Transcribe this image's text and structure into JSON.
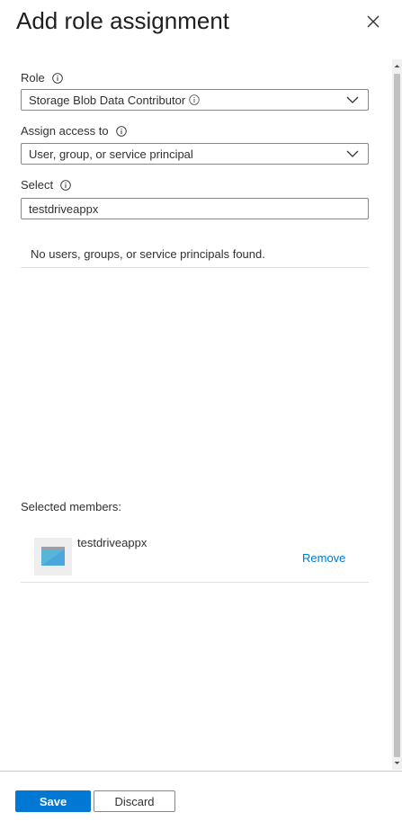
{
  "panel": {
    "title": "Add role assignment"
  },
  "form": {
    "role": {
      "label": "Role",
      "value": "Storage Blob Data Contributor"
    },
    "assign_access": {
      "label": "Assign access to",
      "value": "User, group, or service principal"
    },
    "select": {
      "label": "Select",
      "value": "testdriveappx"
    },
    "empty_message": "No users, groups, or service principals found."
  },
  "selected": {
    "label": "Selected members:",
    "members": [
      {
        "name": "testdriveappx",
        "remove_label": "Remove"
      }
    ]
  },
  "footer": {
    "save_label": "Save",
    "discard_label": "Discard"
  },
  "colors": {
    "accent": "#0078d4",
    "border": "#8a8886"
  }
}
